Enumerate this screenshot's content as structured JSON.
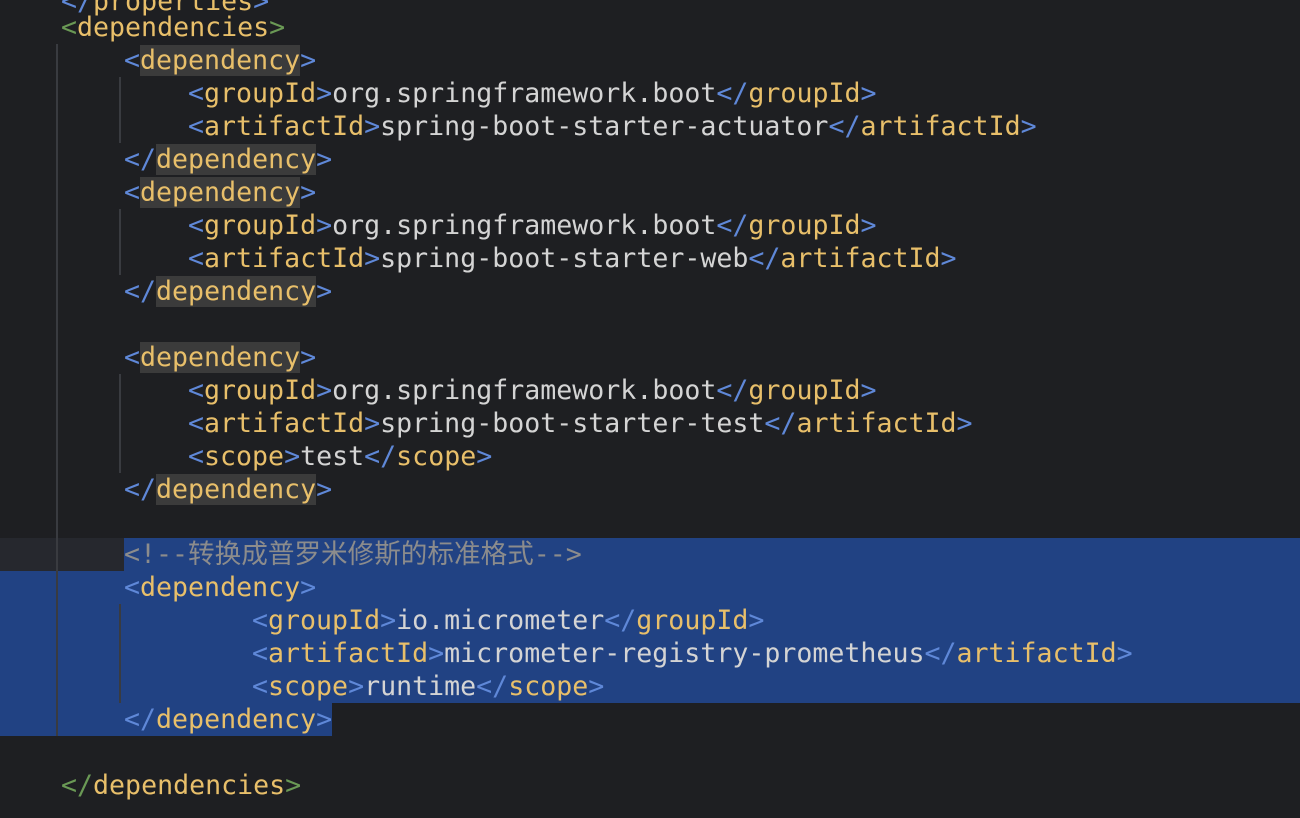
{
  "editor": {
    "language": "xml",
    "colors": {
      "background": "#1e1f22",
      "selection": "#214283",
      "tag_name": "#e8bf6a",
      "bracket": "#5f88d8",
      "text": "#d4d4d4",
      "comment": "#8c8c8c"
    },
    "lines": [
      {
        "open": "</",
        "tag": "properties",
        "close": ">"
      },
      {
        "open": "<",
        "tag": "dependencies",
        "close": ">"
      },
      {
        "open": "<",
        "tag": "dependency",
        "close": ">"
      },
      {
        "open": "<",
        "tag": "groupId",
        "close": ">",
        "text": "org.springframework.boot",
        "end_tag": "groupId"
      },
      {
        "open": "<",
        "tag": "artifactId",
        "close": ">",
        "text": "spring-boot-starter-actuator",
        "end_tag": "artifactId"
      },
      {
        "open": "</",
        "tag": "dependency",
        "close": ">"
      },
      {
        "open": "<",
        "tag": "dependency",
        "close": ">"
      },
      {
        "open": "<",
        "tag": "groupId",
        "close": ">",
        "text": "org.springframework.boot",
        "end_tag": "groupId"
      },
      {
        "open": "<",
        "tag": "artifactId",
        "close": ">",
        "text": "spring-boot-starter-web",
        "end_tag": "artifactId"
      },
      {
        "open": "</",
        "tag": "dependency",
        "close": ">"
      },
      {
        "open": "<",
        "tag": "dependency",
        "close": ">"
      },
      {
        "open": "<",
        "tag": "groupId",
        "close": ">",
        "text": "org.springframework.boot",
        "end_tag": "groupId"
      },
      {
        "open": "<",
        "tag": "artifactId",
        "close": ">",
        "text": "spring-boot-starter-test",
        "end_tag": "artifactId"
      },
      {
        "open": "<",
        "tag": "scope",
        "close": ">",
        "text": "test",
        "end_tag": "scope"
      },
      {
        "open": "</",
        "tag": "dependency",
        "close": ">"
      },
      {
        "comment": "<!--转换成普罗米修斯的标准格式-->"
      },
      {
        "open": "<",
        "tag": "dependency",
        "close": ">"
      },
      {
        "open": "<",
        "tag": "groupId",
        "close": ">",
        "text": "io.micrometer",
        "end_tag": "groupId"
      },
      {
        "open": "<",
        "tag": "artifactId",
        "close": ">",
        "text": "micrometer-registry-prometheus",
        "end_tag": "artifactId"
      },
      {
        "open": "<",
        "tag": "scope",
        "close": ">",
        "text": "runtime",
        "end_tag": "scope"
      },
      {
        "open": "</",
        "tag": "dependency",
        "close": ">"
      },
      {
        "open": "</",
        "tag": "dependencies",
        "close": ">"
      }
    ]
  }
}
